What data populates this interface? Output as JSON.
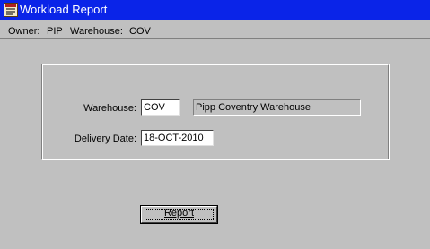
{
  "window": {
    "title": "Workload Report",
    "icon": "oracle-forms-app-icon",
    "titlebar_color": "#0a24e8"
  },
  "context": {
    "owner_label": "Owner:",
    "owner_value": "PIP",
    "warehouse_label": "Warehouse:",
    "warehouse_value": "COV"
  },
  "form": {
    "warehouse_label": "Warehouse:",
    "warehouse_code": "COV",
    "warehouse_name": "Pipp Coventry Warehouse",
    "delivery_date_label": "Delivery Date:",
    "delivery_date": "18-OCT-2010"
  },
  "actions": {
    "report_label": "Report"
  }
}
